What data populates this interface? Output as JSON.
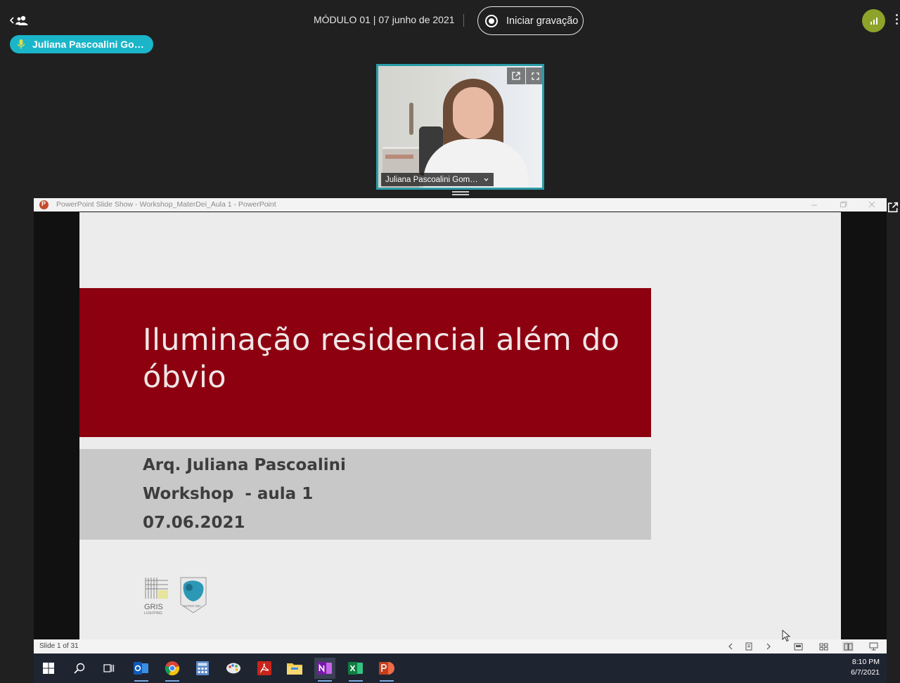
{
  "topbar": {
    "meeting_title": "MÓDULO 01 | 07 junho de 2021",
    "record_label": "Iniciar gravação"
  },
  "speaker": {
    "name": "Juliana Pascoalini Go…"
  },
  "video": {
    "participant_name": "Juliana Pascoalini Gom…"
  },
  "ppt_window": {
    "title": "PowerPoint Slide Show  -  Workshop_MaterDei_Aula 1 - PowerPoint",
    "slide_counter": "Slide 1 of 31"
  },
  "slide": {
    "title_line1": "Iluminação residencial além do",
    "title_line2": "óbvio",
    "author": "Arq. Juliana Pascoalini",
    "workshop": "Workshop  - aula 1",
    "date": "07.06.2021",
    "logo_gris": "GRIS",
    "logo_gris_sub": "LIGHTING",
    "logo_mater": "MATER DEI"
  },
  "taskbar": {
    "time": "8:10 PM",
    "date": "6/7/2021"
  },
  "colors": {
    "background": "#202020",
    "speaker_pill": "#1ab5c9",
    "video_border": "#2a9ca8",
    "signal": "#8ea32a",
    "slide_title_box": "#8c0010",
    "slide_sub_box": "#c8c8c8",
    "taskbar": "#1f2431"
  }
}
